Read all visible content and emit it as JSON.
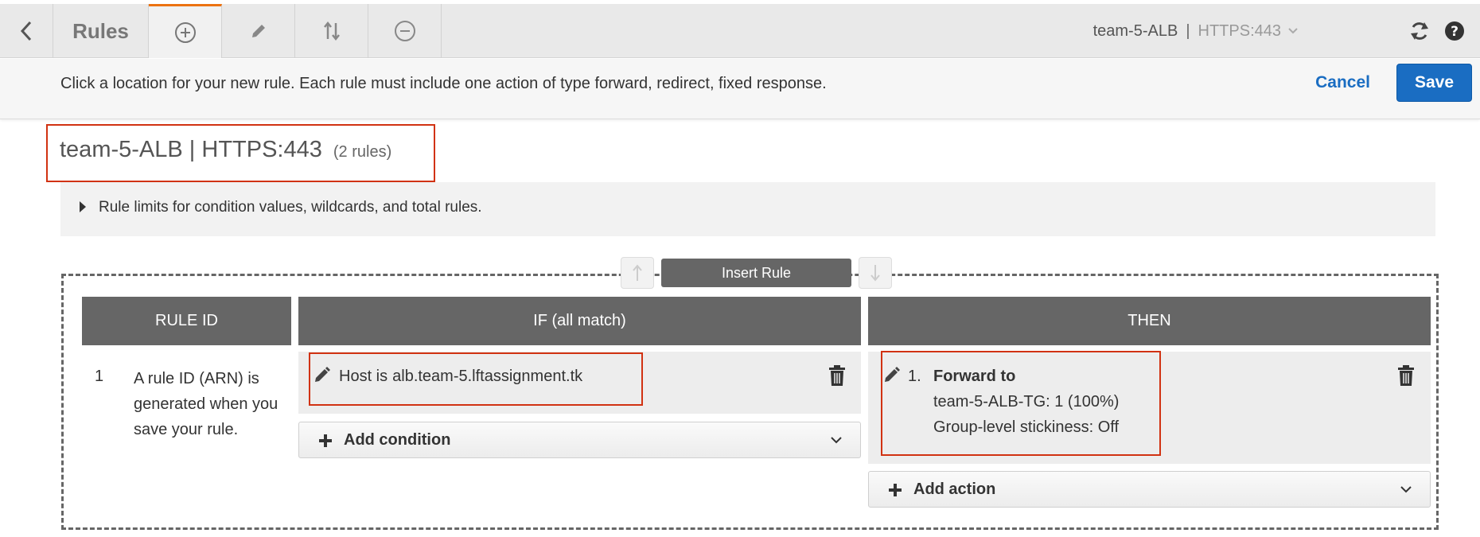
{
  "toolbar": {
    "rules_label": "Rules",
    "listener": {
      "name": "team-5-ALB",
      "separator": "|",
      "protocol": "HTTPS:443"
    },
    "icons": [
      "back-icon",
      "plus-circle-icon",
      "pencil-icon",
      "reorder-icon",
      "minus-circle-icon",
      "refresh-icon",
      "help-icon"
    ],
    "accent_color": "#ec7211"
  },
  "instruction": {
    "text": "Click a location for your new rule. Each rule must include one action of type forward, redirect, fixed response.",
    "cancel_label": "Cancel",
    "save_label": "Save"
  },
  "heading": {
    "title": "team-5-ALB | HTTPS:443",
    "count": "(2 rules)"
  },
  "limits": {
    "text": "Rule limits for condition values, wildcards, and total rules."
  },
  "insert_rule_label": "Insert Rule",
  "columns": {
    "rule_id": "RULE ID",
    "if": "IF (all match)",
    "then": "THEN"
  },
  "rule": {
    "number": "1",
    "id_desc": "A rule ID (ARN) is generated when you save your rule.",
    "condition": {
      "label": "Host is",
      "value": "alb.team-5.lftassignment.tk"
    },
    "add_condition_label": "Add condition",
    "action": {
      "number": "1.",
      "title": "Forward to",
      "target": "team-5-ALB-TG: 1 (100%)",
      "stickiness": "Group-level stickiness: Off"
    },
    "add_action_label": "Add action"
  },
  "colors": {
    "primary": "#1a6dc2",
    "highlight": "#d13212",
    "header_bg": "#666666"
  }
}
